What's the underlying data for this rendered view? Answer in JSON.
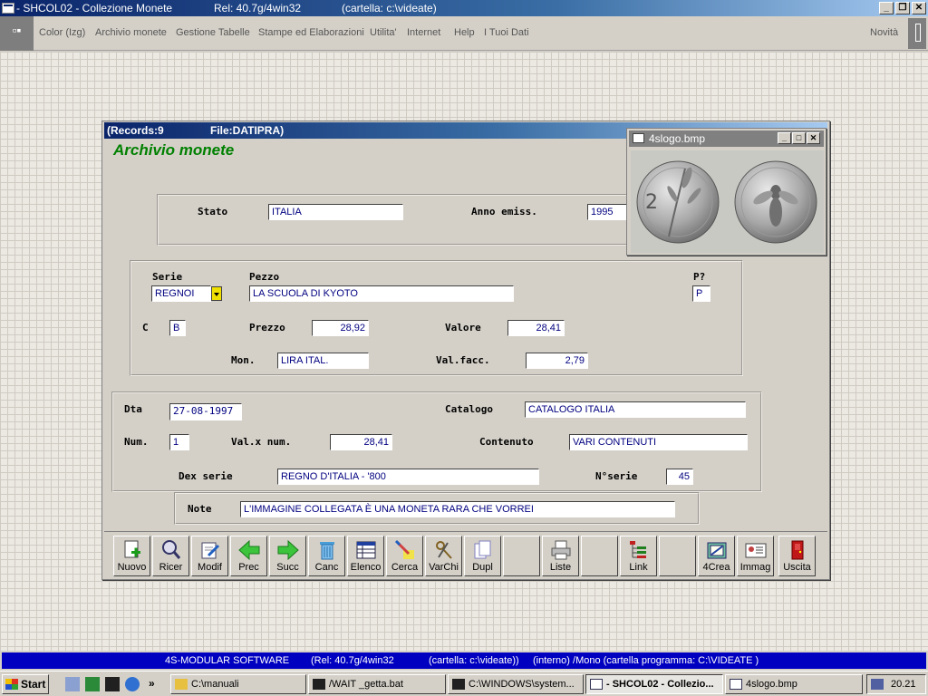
{
  "window": {
    "title": "- SHCOL02 - Collezione Monete",
    "release": "Rel: 40.7g/4win32",
    "folder": "(cartella: c:\\videate)"
  },
  "menu": {
    "items": [
      "Color (Izg)",
      "Archivio monete",
      "Gestione Tabelle",
      "Stampe ed Elaborazioni",
      "Utilita'",
      "Internet",
      "Help",
      "I Tuoi Dati"
    ],
    "right": "Novità"
  },
  "form": {
    "records": "(Records:9",
    "file": "File:DATIPRA)",
    "title": "Archivio monete",
    "labels": {
      "stato": "Stato",
      "anno": "Anno emiss.",
      "serie": "Serie",
      "pezzo": "Pezzo",
      "p": "P?",
      "c": "C",
      "prezzo": "Prezzo",
      "valore": "Valore",
      "mon": "Mon.",
      "valfacc": "Val.facc.",
      "dta": "Dta",
      "catalogo": "Catalogo",
      "num": "Num.",
      "valxnum": "Val.x num.",
      "contenuto": "Contenuto",
      "dexserie": "Dex serie",
      "nserie": "N°serie",
      "note": "Note"
    },
    "values": {
      "stato": "ITALIA",
      "anno": "1995",
      "serie": "REGNOI",
      "pezzo": "LA SCUOLA DI KYOTO",
      "p": "P",
      "c": "B",
      "prezzo": "28,92",
      "valore": "28,41",
      "mon": "LIRA ITAL.",
      "valfacc": "2,79",
      "dta": "27-08-1997",
      "catalogo": "CATALOGO ITALIA",
      "num": "1",
      "valxnum": "28,41",
      "contenuto": "VARI CONTENUTI",
      "dexserie": "REGNO D'ITALIA - '800",
      "nserie": "45",
      "note": "L'IMMAGINE COLLEGATA È UNA MONETA RARA  CHE VORREI"
    }
  },
  "toolbar": {
    "nuovo": "Nuovo",
    "ricer": "Ricer",
    "modif": "Modif",
    "prec": "Prec",
    "succ": "Succ",
    "canc": "Canc",
    "elenco": "Elenco",
    "cerca": "Cerca",
    "varchi": "VarChi",
    "dupl": "Dupl",
    "liste": "Liste",
    "link": "Link",
    "crea": "4Crea",
    "immag": "Immag",
    "uscita": "Uscita"
  },
  "picture": {
    "title": "4slogo.bmp"
  },
  "status": {
    "company": "4S-MODULAR SOFTWARE",
    "release": "(Rel: 40.7g/4win32",
    "folder": "(cartella: c:\\videate))",
    "mode": "(interno)  /Mono  (cartella programma: C:\\VIDEATE )"
  },
  "taskbar": {
    "start": "Start",
    "tasks": [
      "C:\\manuali",
      "/WAIT _getta.bat",
      "C:\\WINDOWS\\system...",
      "- SHCOL02 - Collezio...",
      "4slogo.bmp"
    ],
    "clock": "20.21"
  }
}
